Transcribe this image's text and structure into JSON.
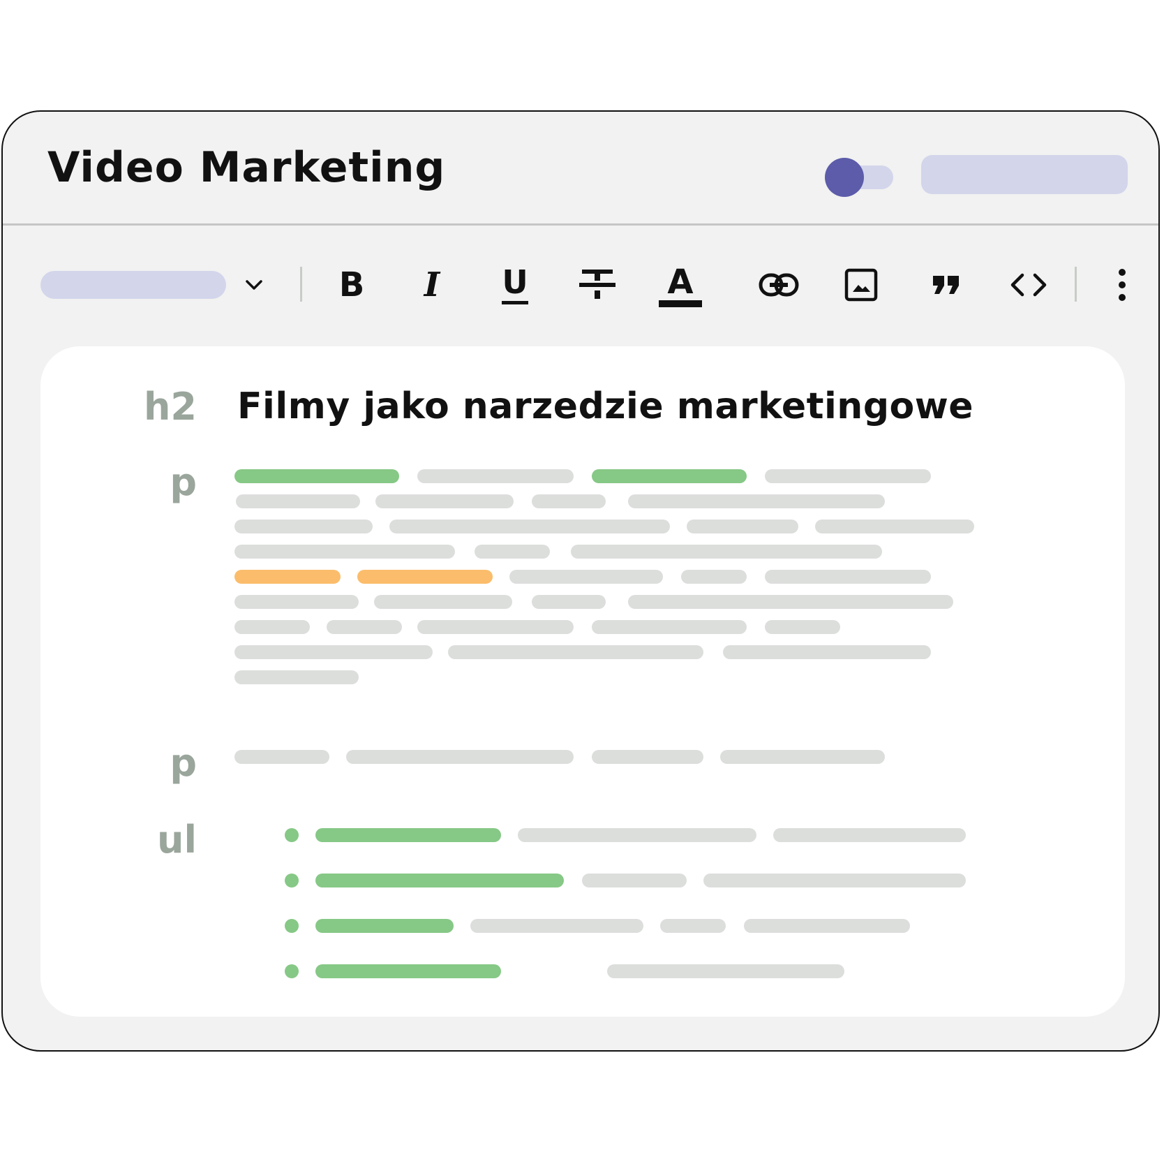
{
  "window": {
    "title": "Video Marketing"
  },
  "header": {
    "toggle": {
      "on": true
    },
    "action_button": {
      "label": ""
    }
  },
  "toolbar": {
    "format_select": {
      "value": ""
    },
    "bold_label": "B",
    "italic_label": "I",
    "underline_label": "U",
    "text_color_label": "A",
    "items": [
      "dropdown",
      "bold",
      "italic",
      "underline",
      "strikethrough",
      "text-color",
      "link",
      "image",
      "quote",
      "code",
      "more"
    ]
  },
  "editor": {
    "blocks": [
      {
        "tag": "h2",
        "text": "Filmy jako narzedzie marketingowe"
      },
      {
        "tag": "p"
      },
      {
        "tag": "p"
      },
      {
        "tag": "ul",
        "items": 4
      }
    ]
  },
  "colors": {
    "accent": "#5c5caa",
    "accent_light": "#d3d5eb",
    "highlight_green": "#86c886",
    "highlight_orange": "#fbbd6b",
    "placeholder_grey": "#dcdedc",
    "tag_grey": "#9aa59c"
  }
}
